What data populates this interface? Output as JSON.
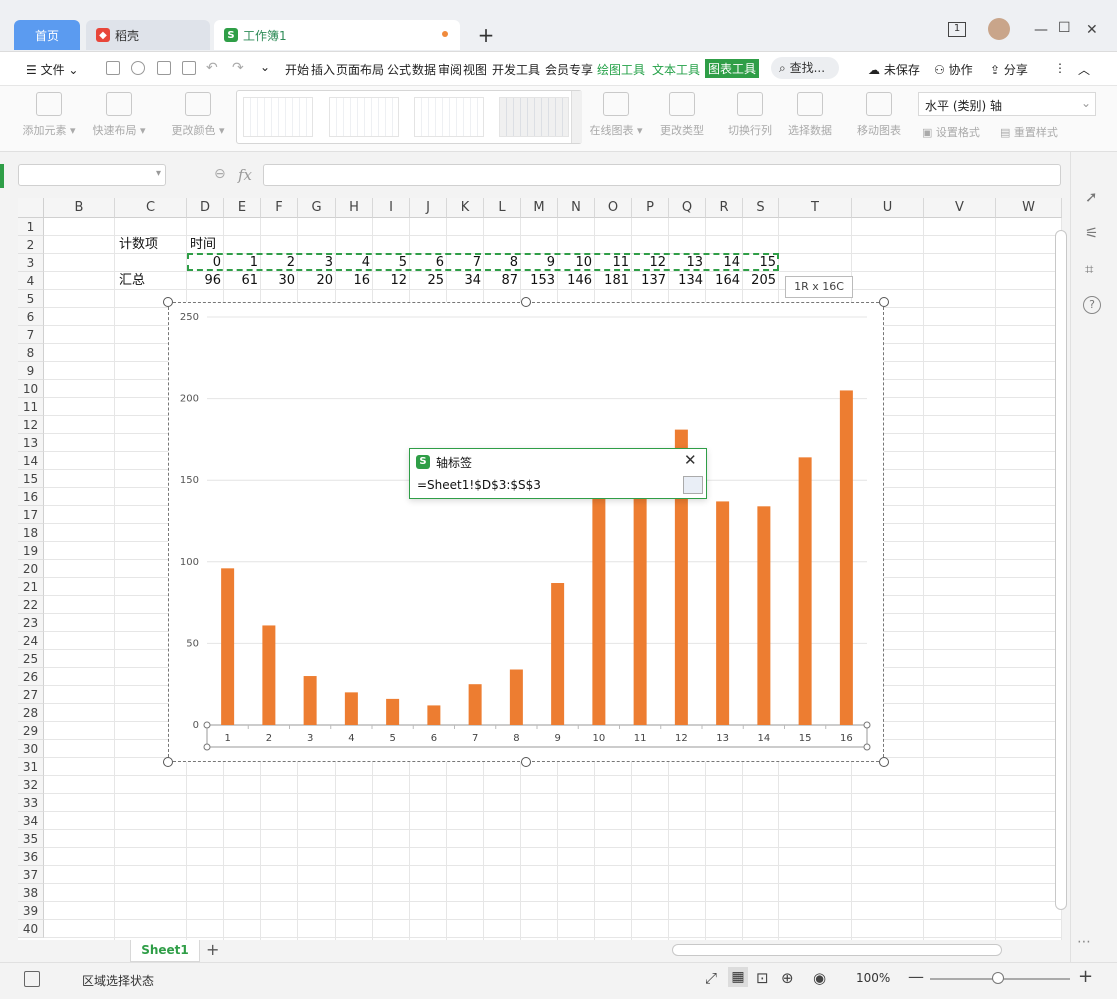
{
  "tabs": {
    "home": "首页",
    "daoke": "稻壳",
    "workbook": "工作簿1"
  },
  "menu": {
    "file": "文件",
    "items": [
      "开始",
      "插入",
      "页面布局",
      "公式",
      "数据",
      "审阅",
      "视图",
      "开发工具",
      "会员专享"
    ],
    "context": [
      "绘图工具",
      "文本工具"
    ],
    "active": "图表工具",
    "search": "查找...",
    "unsaved": "未保存",
    "collab": "协作",
    "share": "分享"
  },
  "ribbon": {
    "add_element": "添加元素",
    "quick_layout": "快速布局",
    "change_color": "更改颜色",
    "online_chart": "在线图表",
    "change_type": "更改类型",
    "switch_row_col": "切换行列",
    "select_data": "选择数据",
    "move_chart": "移动图表",
    "axis_select": "水平 (类别) 轴",
    "set_format": "设置格式",
    "reset_style": "重置样式"
  },
  "formula": {
    "fx": "fx"
  },
  "sheet": {
    "columns": [
      "B",
      "C",
      "D",
      "E",
      "F",
      "G",
      "H",
      "I",
      "J",
      "K",
      "L",
      "M",
      "N",
      "O",
      "P",
      "Q",
      "R",
      "S",
      "T",
      "U",
      "V",
      "W"
    ],
    "label_count": "计数项",
    "label_time": "时间",
    "label_total": "汇总",
    "row3": [
      "0",
      "1",
      "2",
      "3",
      "4",
      "5",
      "6",
      "7",
      "8",
      "9",
      "10",
      "11",
      "12",
      "13",
      "14",
      "15"
    ],
    "row4": [
      "96",
      "61",
      "30",
      "20",
      "16",
      "12",
      "25",
      "34",
      "87",
      "153",
      "146",
      "181",
      "137",
      "134",
      "164",
      "205"
    ],
    "selection_tip": "1R x 16C"
  },
  "chart_data": {
    "type": "bar",
    "categories": [
      "1",
      "2",
      "3",
      "4",
      "5",
      "6",
      "7",
      "8",
      "9",
      "10",
      "11",
      "12",
      "13",
      "14",
      "15",
      "16"
    ],
    "values": [
      96,
      61,
      30,
      20,
      16,
      12,
      25,
      34,
      87,
      140,
      140,
      181,
      137,
      134,
      164,
      205
    ],
    "yticks": [
      "250",
      "200",
      "150",
      "100",
      "50",
      "0"
    ],
    "ylim": [
      0,
      250
    ],
    "bar_color": "#ed7d31",
    "title": "",
    "xlabel": "",
    "ylabel": ""
  },
  "dialog": {
    "title": "轴标签",
    "value": "=Sheet1!$D$3:$S$3"
  },
  "sheet_tab": "Sheet1",
  "status": {
    "mode": "区域选择状态",
    "zoom": "100%"
  },
  "colors": {
    "accent": "#2f9e47",
    "bar": "#ed7d31"
  }
}
